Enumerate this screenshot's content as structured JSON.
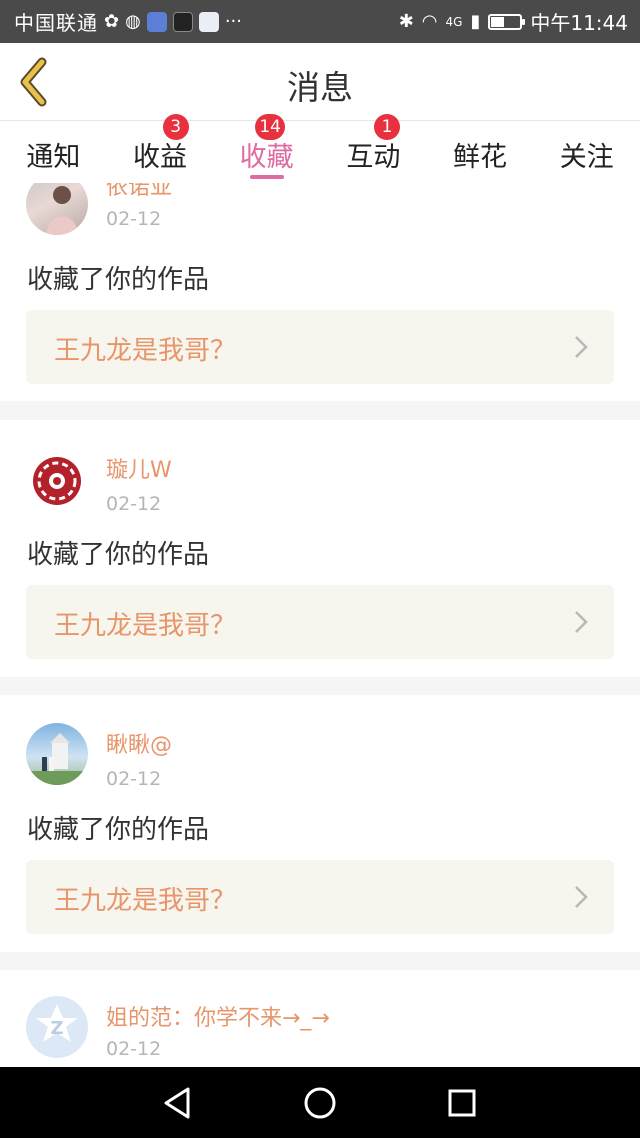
{
  "status_bar": {
    "carrier": "中国联通",
    "network": "4G",
    "time": "中午11:44",
    "battery_level": 0.45
  },
  "header": {
    "title": "消息",
    "back_icon": "chevron-left-icon",
    "accent_color": "#e8c24a"
  },
  "tabs": [
    {
      "label": "通知",
      "badge": "",
      "active": false
    },
    {
      "label": "收益",
      "badge": "3",
      "active": false
    },
    {
      "label": "收藏",
      "badge": "14",
      "active": true
    },
    {
      "label": "互动",
      "badge": "1",
      "active": false
    },
    {
      "label": "鲜花",
      "badge": "",
      "active": false
    },
    {
      "label": "关注",
      "badge": "",
      "active": false
    }
  ],
  "feed": [
    {
      "username": "依诺亚",
      "date": "02-12",
      "action": "收藏了你的作品",
      "work_title": "王九龙是我哥？"
    },
    {
      "username": "璇儿W",
      "date": "02-12",
      "action": "收藏了你的作品",
      "work_title": "王九龙是我哥？"
    },
    {
      "username": "瞅瞅@",
      "date": "02-12",
      "action": "收藏了你的作品",
      "work_title": "王九龙是我哥？"
    },
    {
      "username": "姐的范：你学不来→_→",
      "date": "02-12",
      "action": "",
      "work_title": ""
    }
  ],
  "colors": {
    "active_tab": "#e06aa3",
    "badge": "#e8313f",
    "username": "#e8956a",
    "work_card_bg": "#f6f5ee"
  },
  "nav_icons": [
    "back-triangle-icon",
    "home-circle-icon",
    "recents-square-icon"
  ]
}
